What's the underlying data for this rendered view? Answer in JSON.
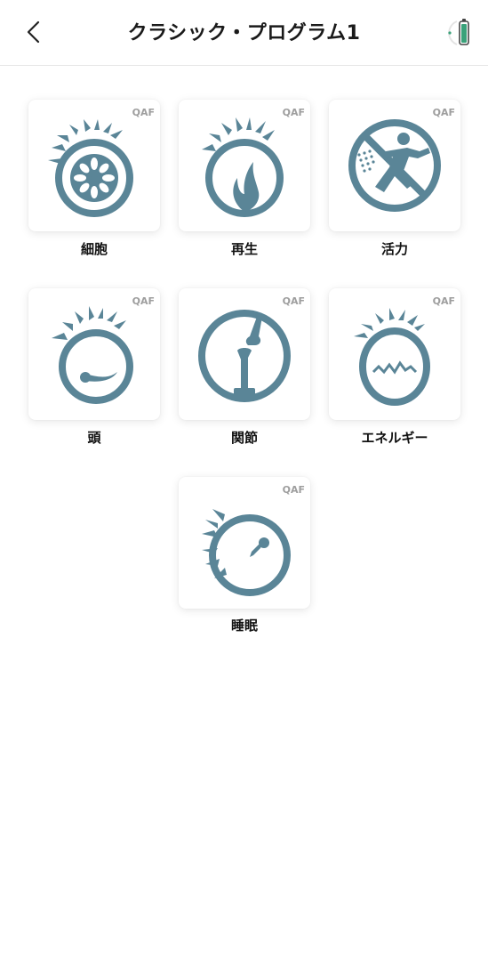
{
  "header": {
    "title": "クラシック・プログラム1",
    "back_icon": "chevron-left-icon",
    "battery_icon": "battery-icon"
  },
  "colors": {
    "icon": "#5a8597",
    "battery": "#3aa27a"
  },
  "programs": [
    {
      "label": "細胞",
      "badge": "QAF",
      "icon": "cell-icon"
    },
    {
      "label": "再生",
      "badge": "QAF",
      "icon": "regeneration-icon"
    },
    {
      "label": "活力",
      "badge": "QAF",
      "icon": "vitality-icon"
    },
    {
      "label": "頭",
      "badge": "QAF",
      "icon": "head-icon"
    },
    {
      "label": "関節",
      "badge": "QAF",
      "icon": "joint-icon"
    },
    {
      "label": "エネルギー",
      "badge": "QAF",
      "icon": "energy-icon"
    },
    {
      "label": "睡眠",
      "badge": "QAF",
      "icon": "sleep-icon"
    }
  ]
}
